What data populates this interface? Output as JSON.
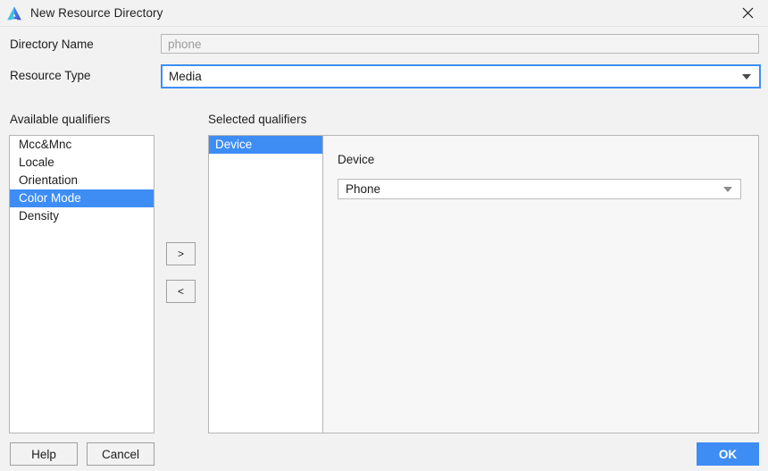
{
  "window": {
    "title": "New Resource Directory",
    "icon": "android-studio-logo-icon",
    "close_icon": "close-icon"
  },
  "colors": {
    "accent": "#3d8df5",
    "focus_border": "#3c8ef5",
    "dialog_background": "#f2f2f2",
    "field_background": "#ffffff",
    "disabled_field_background": "#f4f4f4",
    "border": "#b6b6b6",
    "text": "#1d1d1d",
    "placeholder_text": "#9b9b9b"
  },
  "form": {
    "directory_name": {
      "label": "Directory Name",
      "value": "",
      "placeholder": "phone"
    },
    "resource_type": {
      "label": "Resource Type",
      "value": "Media",
      "arrow_icon": "chevron-down-icon"
    }
  },
  "available_qualifiers": {
    "caption": "Available qualifiers",
    "items": [
      {
        "label": "Mcc&Mnc",
        "selected": false
      },
      {
        "label": "Locale",
        "selected": false
      },
      {
        "label": "Orientation",
        "selected": false
      },
      {
        "label": "Color Mode",
        "selected": true
      },
      {
        "label": "Density",
        "selected": false
      }
    ]
  },
  "transfer": {
    "move_right_label": ">",
    "move_left_label": "<"
  },
  "selected_qualifiers": {
    "caption": "Selected qualifiers",
    "items": [
      {
        "label": "Device",
        "selected": true
      }
    ],
    "detail": {
      "label": "Device",
      "combo_value": "Phone",
      "arrow_icon": "chevron-down-icon"
    }
  },
  "footer": {
    "help_label": "Help",
    "cancel_label": "Cancel",
    "ok_label": "OK"
  }
}
